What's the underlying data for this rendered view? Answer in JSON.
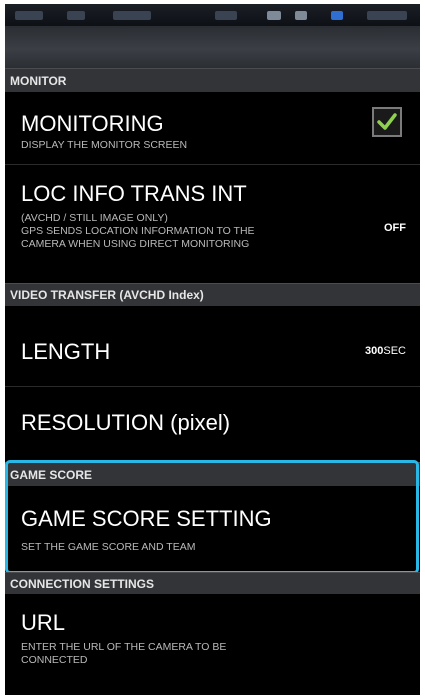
{
  "colors": {
    "highlight": "#29b8e6",
    "checkmark": "#8fd14f",
    "section_header_bg": "#323438",
    "background": "#000000"
  },
  "sections": {
    "monitor": {
      "header": "MONITOR",
      "monitoring": {
        "title": "MONITORING",
        "subtitle": "DISPLAY THE MONITOR SCREEN",
        "checked": true,
        "check_icon": "checkmark-icon"
      },
      "loc_info": {
        "title": "LOC INFO TRANS INT",
        "subtitle": "(AVCHD / STILL IMAGE ONLY)\nGPS SENDS LOCATION INFORMATION TO THE\nCAMERA WHEN USING DIRECT MONITORING",
        "value": "OFF"
      }
    },
    "video_transfer": {
      "header": "VIDEO TRANSFER (AVCHD Index)",
      "length": {
        "title": "LENGTH",
        "value_number": "300",
        "value_unit": "SEC"
      },
      "resolution": {
        "title": "RESOLUTION (pixel)"
      }
    },
    "game_score": {
      "header": "GAME SCORE",
      "setting": {
        "title": "GAME SCORE SETTING",
        "subtitle": "SET THE GAME SCORE AND TEAM"
      }
    },
    "connection": {
      "header": "CONNECTION SETTINGS",
      "url": {
        "title": "URL",
        "subtitle": "ENTER THE URL OF THE CAMERA TO BE\nCONNECTED"
      }
    }
  }
}
